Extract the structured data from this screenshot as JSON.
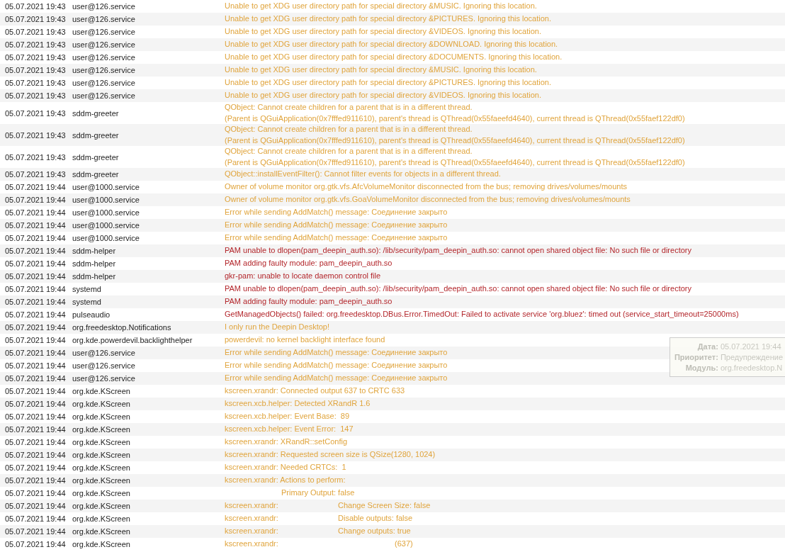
{
  "log": [
    {
      "time": "05.07.2021 19:43",
      "source": "user@126.service",
      "kind": "warning",
      "message": "Unable to get XDG user directory path for special directory &MUSIC. Ignoring this location."
    },
    {
      "time": "05.07.2021 19:43",
      "source": "user@126.service",
      "kind": "warning",
      "message": "Unable to get XDG user directory path for special directory &PICTURES. Ignoring this location."
    },
    {
      "time": "05.07.2021 19:43",
      "source": "user@126.service",
      "kind": "warning",
      "message": "Unable to get XDG user directory path for special directory &VIDEOS. Ignoring this location."
    },
    {
      "time": "05.07.2021 19:43",
      "source": "user@126.service",
      "kind": "warning",
      "message": "Unable to get XDG user directory path for special directory &DOWNLOAD. Ignoring this location."
    },
    {
      "time": "05.07.2021 19:43",
      "source": "user@126.service",
      "kind": "warning",
      "message": "Unable to get XDG user directory path for special directory &DOCUMENTS. Ignoring this location."
    },
    {
      "time": "05.07.2021 19:43",
      "source": "user@126.service",
      "kind": "warning",
      "message": "Unable to get XDG user directory path for special directory &MUSIC. Ignoring this location."
    },
    {
      "time": "05.07.2021 19:43",
      "source": "user@126.service",
      "kind": "warning",
      "message": "Unable to get XDG user directory path for special directory &PICTURES. Ignoring this location."
    },
    {
      "time": "05.07.2021 19:43",
      "source": "user@126.service",
      "kind": "warning",
      "message": "Unable to get XDG user directory path for special directory &VIDEOS. Ignoring this location."
    },
    {
      "time": "05.07.2021 19:43",
      "source": "sddm-greeter",
      "kind": "warning",
      "message": "QObject: Cannot create children for a parent that is in a different thread.\n(Parent is QGuiApplication(0x7fffed911610), parent's thread is QThread(0x55faeefd4640), current thread is QThread(0x55faef122df0)"
    },
    {
      "time": "05.07.2021 19:43",
      "source": "sddm-greeter",
      "kind": "warning",
      "message": "QObject: Cannot create children for a parent that is in a different thread.\n(Parent is QGuiApplication(0x7fffed911610), parent's thread is QThread(0x55faeefd4640), current thread is QThread(0x55faef122df0)"
    },
    {
      "time": "05.07.2021 19:43",
      "source": "sddm-greeter",
      "kind": "warning",
      "message": "QObject: Cannot create children for a parent that is in a different thread.\n(Parent is QGuiApplication(0x7fffed911610), parent's thread is QThread(0x55faeefd4640), current thread is QThread(0x55faef122df0)"
    },
    {
      "time": "05.07.2021 19:43",
      "source": "sddm-greeter",
      "kind": "warning",
      "message": "QObject::installEventFilter(): Cannot filter events for objects in a different thread."
    },
    {
      "time": "05.07.2021 19:44",
      "source": "user@1000.service",
      "kind": "warning",
      "message": "Owner of volume monitor org.gtk.vfs.AfcVolumeMonitor disconnected from the bus; removing drives/volumes/mounts"
    },
    {
      "time": "05.07.2021 19:44",
      "source": "user@1000.service",
      "kind": "warning",
      "message": "Owner of volume monitor org.gtk.vfs.GoaVolumeMonitor disconnected from the bus; removing drives/volumes/mounts"
    },
    {
      "time": "05.07.2021 19:44",
      "source": "user@1000.service",
      "kind": "warning",
      "message": "Error while sending AddMatch() message: Соединение закрыто"
    },
    {
      "time": "05.07.2021 19:44",
      "source": "user@1000.service",
      "kind": "warning",
      "message": "Error while sending AddMatch() message: Соединение закрыто"
    },
    {
      "time": "05.07.2021 19:44",
      "source": "user@1000.service",
      "kind": "warning",
      "message": "Error while sending AddMatch() message: Соединение закрыто"
    },
    {
      "time": "05.07.2021 19:44",
      "source": "sddm-helper",
      "kind": "error",
      "message": "PAM unable to dlopen(pam_deepin_auth.so): /lib/security/pam_deepin_auth.so: cannot open shared object file: No such file or directory"
    },
    {
      "time": "05.07.2021 19:44",
      "source": "sddm-helper",
      "kind": "error",
      "message": "PAM adding faulty module: pam_deepin_auth.so"
    },
    {
      "time": "05.07.2021 19:44",
      "source": "sddm-helper",
      "kind": "error",
      "message": "gkr-pam: unable to locate daemon control file"
    },
    {
      "time": "05.07.2021 19:44",
      "source": "systemd",
      "kind": "error",
      "message": "PAM unable to dlopen(pam_deepin_auth.so): /lib/security/pam_deepin_auth.so: cannot open shared object file: No such file or directory"
    },
    {
      "time": "05.07.2021 19:44",
      "source": "systemd",
      "kind": "error",
      "message": "PAM adding faulty module: pam_deepin_auth.so"
    },
    {
      "time": "05.07.2021 19:44",
      "source": "pulseaudio",
      "kind": "error",
      "message": "GetManagedObjects() failed: org.freedesktop.DBus.Error.TimedOut: Failed to activate service 'org.bluez': timed out (service_start_timeout=25000ms)"
    },
    {
      "time": "05.07.2021 19:44",
      "source": "org.freedesktop.Notifications",
      "kind": "warning",
      "message": "I only run the Deepin Desktop!"
    },
    {
      "time": "05.07.2021 19:44",
      "source": "org.kde.powerdevil.backlighthelper",
      "kind": "warning",
      "message": "powerdevil: no kernel backlight interface found"
    },
    {
      "time": "05.07.2021 19:44",
      "source": "user@126.service",
      "kind": "warning",
      "message": "Error while sending AddMatch() message: Соединение закрыто"
    },
    {
      "time": "05.07.2021 19:44",
      "source": "user@126.service",
      "kind": "warning",
      "message": "Error while sending AddMatch() message: Соединение закрыто"
    },
    {
      "time": "05.07.2021 19:44",
      "source": "user@126.service",
      "kind": "warning",
      "message": "Error while sending AddMatch() message: Соединение закрыто"
    },
    {
      "time": "05.07.2021 19:44",
      "source": "org.kde.KScreen",
      "kind": "warning",
      "message": "kscreen.xrandr: Connected output 637 to CRTC 633"
    },
    {
      "time": "05.07.2021 19:44",
      "source": "org.kde.KScreen",
      "kind": "warning",
      "message": "kscreen.xcb.helper: Detected XRandR 1.6"
    },
    {
      "time": "05.07.2021 19:44",
      "source": "org.kde.KScreen",
      "kind": "warning",
      "message": "kscreen.xcb.helper: Event Base:  89"
    },
    {
      "time": "05.07.2021 19:44",
      "source": "org.kde.KScreen",
      "kind": "warning",
      "message": "kscreen.xcb.helper: Event Error:  147"
    },
    {
      "time": "05.07.2021 19:44",
      "source": "org.kde.KScreen",
      "kind": "warning",
      "message": "kscreen.xrandr: XRandR::setConfig"
    },
    {
      "time": "05.07.2021 19:44",
      "source": "org.kde.KScreen",
      "kind": "warning",
      "message": "kscreen.xrandr: Requested screen size is QSize(1280, 1024)"
    },
    {
      "time": "05.07.2021 19:44",
      "source": "org.kde.KScreen",
      "kind": "warning",
      "message": "kscreen.xrandr: Needed CRTCs:  1"
    },
    {
      "time": "05.07.2021 19:44",
      "source": "org.kde.KScreen",
      "kind": "warning",
      "message": "kscreen.xrandr: Actions to perform:"
    },
    {
      "time": "05.07.2021 19:44",
      "source": "org.kde.KScreen",
      "kind": "warning",
      "message": "\tPrimary Output: false"
    },
    {
      "time": "05.07.2021 19:44",
      "source": "org.kde.KScreen",
      "kind": "warning",
      "message": "kscreen.xrandr:\t\tChange Screen Size: false"
    },
    {
      "time": "05.07.2021 19:44",
      "source": "org.kde.KScreen",
      "kind": "warning",
      "message": "kscreen.xrandr:\t\tDisable outputs: false"
    },
    {
      "time": "05.07.2021 19:44",
      "source": "org.kde.KScreen",
      "kind": "warning",
      "message": "kscreen.xrandr:\t\tChange outputs: true"
    },
    {
      "time": "05.07.2021 19:44",
      "source": "org.kde.KScreen",
      "kind": "warning",
      "message": "kscreen.xrandr:\t\t\t(637)"
    }
  ],
  "tooltip": [
    {
      "label": "Дата:",
      "value": "05.07.2021 19:44"
    },
    {
      "label": "Приоритет:",
      "value": "Предупреждение"
    },
    {
      "label": "Модуль:",
      "value": "org.freedesktop.N"
    }
  ]
}
